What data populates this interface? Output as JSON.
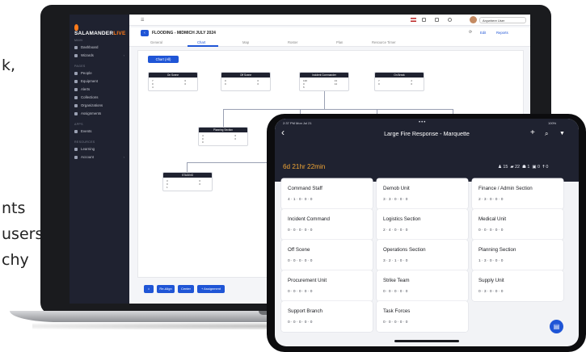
{
  "background_text": [
    "k,",
    "nts",
    "users,",
    "chy"
  ],
  "app": {
    "brand": {
      "main": "SALAMANDER",
      "accent": "LIVE"
    },
    "sidebar": {
      "sections": [
        "MAIN",
        "PAGES",
        "APPS",
        "RESOURCES"
      ],
      "items": [
        {
          "label": "Dashboard",
          "icon": "dashboard-icon"
        },
        {
          "label": "Wizards",
          "icon": "wand-icon"
        },
        {
          "label": "People",
          "icon": "people-icon"
        },
        {
          "label": "Equipment",
          "icon": "equipment-icon"
        },
        {
          "label": "Alerts",
          "icon": "alert-icon"
        },
        {
          "label": "Collections",
          "icon": "collection-icon"
        },
        {
          "label": "Organizations",
          "icon": "organization-icon"
        },
        {
          "label": "Assignments",
          "icon": "assignment-icon"
        },
        {
          "label": "Events",
          "icon": "event-icon"
        },
        {
          "label": "Learning",
          "icon": "learning-icon"
        },
        {
          "label": "Account",
          "icon": "account-icon"
        }
      ]
    },
    "topbar": {
      "user": "Anywhere User"
    },
    "page": {
      "title": "FLOODING - MIDMICH JULY 2024",
      "actions": [
        "Edit",
        "Reports"
      ],
      "tabs": [
        "General",
        "Chart",
        "Map",
        "Roster",
        "Plan",
        "Resource Timer"
      ],
      "chart_button": "Chart (All)",
      "nodes": [
        {
          "label": "On Scene",
          "stats": [
            "7",
            "0",
            "0",
            "0",
            "4"
          ]
        },
        {
          "label": "Off Scene",
          "stats": [
            "0",
            "0",
            "0",
            "0"
          ]
        },
        {
          "label": "Incident Commander",
          "stats": [
            "130",
            "13",
            "0",
            "14",
            "6"
          ]
        },
        {
          "label": "On Break",
          "stats": [
            "7",
            "2",
            "0",
            "0"
          ]
        },
        {
          "label": "Planning Section",
          "stats": [
            "4",
            "0",
            "0",
            "0",
            "0"
          ]
        },
        {
          "label": "Operations Section",
          "stats": [
            "48",
            "7",
            "26",
            "0",
            "1"
          ]
        },
        {
          "label": "Logistics Section",
          "stats": [
            "3",
            "0",
            "0",
            "0"
          ]
        },
        {
          "label": "Finance / Admin Section",
          "stats": [
            "3",
            "0",
            "0",
            "0"
          ]
        },
        {
          "label": "STAGING",
          "stats": [
            "3",
            "0",
            "0",
            "0",
            "1"
          ]
        }
      ],
      "bottom_buttons": [
        "Re-Align",
        "Center",
        "+ Assignment"
      ]
    }
  },
  "tablet": {
    "status_time": "2:37 PM   Mon Jul 21",
    "status_right": "100%",
    "title": "Large Fire Response - Marquette",
    "timer": "6d 21hr 22min",
    "stats": {
      "people": "15",
      "vehicles": "22",
      "teams": "1",
      "equipment": "0",
      "other": "0"
    },
    "cards": [
      {
        "title": "Command Staff",
        "stats": "4 · 1 · 0 · 0 · 0"
      },
      {
        "title": "Demob Unit",
        "stats": "3 · 3 · 0 · 0 · 0"
      },
      {
        "title": "Finance / Admin Section",
        "stats": "2 · 3 · 0 · 0 · 0"
      },
      {
        "title": "Incident Command",
        "stats": "0 · 0 · 0 · 0 · 0"
      },
      {
        "title": "Logistics Section",
        "stats": "2 · 4 · 0 · 0 · 0"
      },
      {
        "title": "Medical Unit",
        "stats": "0 · 0 · 0 · 0 · 0"
      },
      {
        "title": "Off Scene",
        "stats": "0 · 0 · 0 · 0 · 0"
      },
      {
        "title": "Operations Section",
        "stats": "3 · 2 · 1 · 0 · 0"
      },
      {
        "title": "Planning Section",
        "stats": "1 · 3 · 0 · 0 · 0"
      },
      {
        "title": "Procurement Unit",
        "stats": "0 · 0 · 0 · 0 · 0"
      },
      {
        "title": "Strike Team",
        "stats": "0 · 0 · 0 · 0 · 0"
      },
      {
        "title": "Supply Unit",
        "stats": "0 · 3 · 0 · 0 · 0"
      },
      {
        "title": "Support Branch",
        "stats": "0 · 0 · 0 · 0 · 0"
      },
      {
        "title": "Task Forces",
        "stats": "0 · 0 · 0 · 0 · 0"
      }
    ]
  },
  "colors": {
    "accent": "#1f55d6",
    "sidebar": "#1f2230",
    "timer": "#f0a535",
    "brand_accent": "#ff7a1a"
  }
}
